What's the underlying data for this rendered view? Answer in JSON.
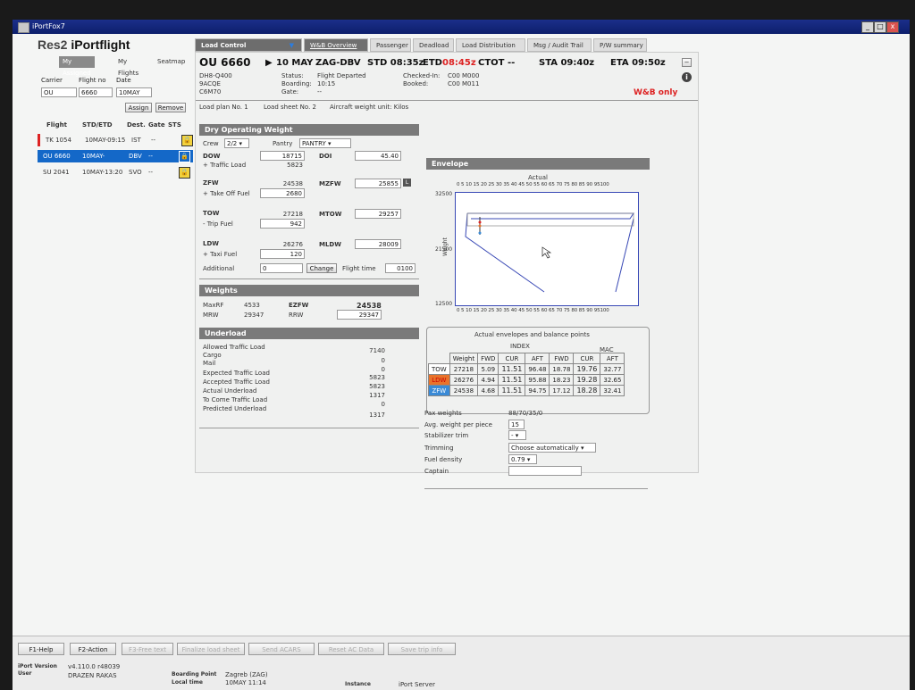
{
  "window": {
    "title": "iPortFox7",
    "min": "_",
    "max": "□",
    "close": "x"
  },
  "brand": {
    "name": "Res2",
    "product": "iPortflight"
  },
  "left": {
    "tabs": [
      "My Assigned",
      "My Flights",
      "Seatmap"
    ],
    "labels": {
      "carrier": "Carrier",
      "flight_no": "Flight no",
      "date": "Date"
    },
    "values": {
      "carrier": "OU",
      "flight_no": "6660",
      "date": "10MAY"
    },
    "assign": "Assign",
    "remove": "Remove",
    "headers": {
      "flight": "Flight",
      "std": "STD/ETD",
      "dest": "Dest.",
      "gate": "Gate",
      "sts": "STS"
    },
    "flights": [
      {
        "flight": "TK 1054",
        "std": "10MAY-09:15",
        "dest": "IST",
        "gate": "--"
      },
      {
        "flight": "OU 6660",
        "std": "10MAY-",
        "dest": "DBV",
        "gate": "--"
      },
      {
        "flight": "SU 2041",
        "std": "10MAY-13:20",
        "dest": "SVO",
        "gate": "--"
      }
    ]
  },
  "tabs": [
    "Load Control",
    "W&B Overview",
    "Passenger",
    "Deadload",
    "Load Distribution",
    "Msg / Audit Trail",
    "P/W summary"
  ],
  "flight": {
    "number": "OU 6660",
    "date": "10 MAY",
    "route": "ZAG-DBV",
    "std": "STD 08:35z",
    "etd_lbl": "ETD",
    "etd": "08:45z",
    "ctot": "CTOT --",
    "sta": "STA 09:40z",
    "eta": "ETA 09:50z",
    "aircraft": "DH8-Q400",
    "reg": "9ACQE",
    "config": "C6M70",
    "status_lbl": "Status:",
    "status": "Flight Departed",
    "boarding_lbl": "Boarding:",
    "boarding": "10:15",
    "gate_lbl": "Gate:",
    "gate": "--",
    "checked_lbl": "Checked-In:",
    "checked": "C00 M000",
    "booked_lbl": "Booked:",
    "booked": "C00 M011",
    "wb_only": "W&B only",
    "load_plan": "Load plan No. 1",
    "load_sheet": "Load sheet No. 2",
    "unit": "Aircraft weight unit: Kilos"
  },
  "dow": {
    "title": "Dry Operating Weight",
    "crew_lbl": "Crew",
    "crew": "2/2",
    "pantry_lbl": "Pantry",
    "pantry": "PANTRY",
    "rows": [
      {
        "lbl": "DOW",
        "val": "18715",
        "k": "DOI",
        "kv": "45.40"
      },
      {
        "lbl": "+ Traffic Load",
        "val": "5823"
      },
      {
        "lbl": "ZFW",
        "val": "24538",
        "k": "MZFW",
        "kv": "25855"
      },
      {
        "lbl": "+ Take Off Fuel",
        "val": "2680"
      },
      {
        "lbl": "TOW",
        "val": "27218",
        "k": "MTOW",
        "kv": "29257"
      },
      {
        "lbl": "- Trip Fuel",
        "val": "942"
      },
      {
        "lbl": "LDW",
        "val": "26276",
        "k": "MLDW",
        "kv": "28009"
      },
      {
        "lbl": "+ Taxi Fuel",
        "val": "120"
      },
      {
        "lbl": "Additional",
        "val": "0"
      }
    ],
    "change": "Change",
    "flight_time_lbl": "Flight time",
    "flight_time": "0100"
  },
  "weights": {
    "title": "Weights",
    "maxrf_lbl": "MaxRF",
    "maxrf": "4533",
    "ezfw_lbl": "EZFW",
    "ezfw": "24538",
    "mrw_lbl": "MRW",
    "mrw": "29347",
    "rrw_lbl": "RRW",
    "rrw": "29347"
  },
  "underload": {
    "title": "Underload",
    "rows": [
      {
        "lbl": "Allowed Traffic Load",
        "val": "7140"
      },
      {
        "lbl": "Cargo",
        "val": "0"
      },
      {
        "lbl": "Mail",
        "val": "0"
      },
      {
        "lbl": "Expected Traffic Load",
        "val": "5823"
      },
      {
        "lbl": "Accepted Traffic Load",
        "val": "5823"
      },
      {
        "lbl": "Actual Underload",
        "val": "1317"
      },
      {
        "lbl": "To Come Traffic Load",
        "val": "0"
      },
      {
        "lbl": "Predicted Underload",
        "val": "1317"
      }
    ]
  },
  "envelope": {
    "title": "Envelope",
    "subtitle": "Actual",
    "ylabel": "Weight",
    "y_ticks": [
      "32500",
      "21500",
      "12500"
    ],
    "x_ticks": "0 5 10 15 20 25 30 35 40 45 50 55 60 65 70 75 80 85 90 95100"
  },
  "balance": {
    "title": "Actual envelopes and balance points",
    "index_lbl": "INDEX",
    "mac_lbl": "MAC",
    "cols": [
      "Weight",
      "FWD",
      "CUR",
      "AFT",
      "FWD",
      "CUR",
      "AFT"
    ],
    "rows": [
      {
        "name": "TOW",
        "color": "#ffffff",
        "v": [
          "27218",
          "5.09",
          "11.51",
          "96.48",
          "18.78",
          "19.76",
          "32.77"
        ]
      },
      {
        "name": "LDW",
        "color": "#e8732b",
        "v": [
          "26276",
          "4.94",
          "11.51",
          "95.88",
          "18.23",
          "19.28",
          "32.65"
        ]
      },
      {
        "name": "ZFW",
        "color": "#3a8ad6",
        "v": [
          "24538",
          "4.68",
          "11.51",
          "94.75",
          "17.12",
          "18.28",
          "32.41"
        ]
      }
    ]
  },
  "misc": {
    "pax_lbl": "Pax weights",
    "pax": "88/70/35/0",
    "avg_lbl": "Avg. weight per piece",
    "avg": "15",
    "stab_lbl": "Stabilizer trim",
    "stab": "-",
    "trim_lbl": "Trimming",
    "trim": "Choose automatically",
    "fuel_lbl": "Fuel density",
    "fuel": "0.79",
    "captain_lbl": "Captain"
  },
  "bottom": {
    "buttons": [
      "F1-Help",
      "F2-Action",
      "F3-Free text",
      "Finalize load sheet",
      "Send ACARS",
      "Reset AC Data",
      "Save trip info"
    ],
    "version_lbl": "iPort Version",
    "version": "v4.110.0 r48039",
    "user_lbl": "User",
    "user": "DRAZEN RAKAS",
    "bp_lbl": "Boarding Point",
    "bp": "Zagreb (ZAG)",
    "lt_lbl": "Local time",
    "lt": "10MAY 11:14",
    "inst_lbl": "Instance",
    "inst": "iPort Server"
  }
}
